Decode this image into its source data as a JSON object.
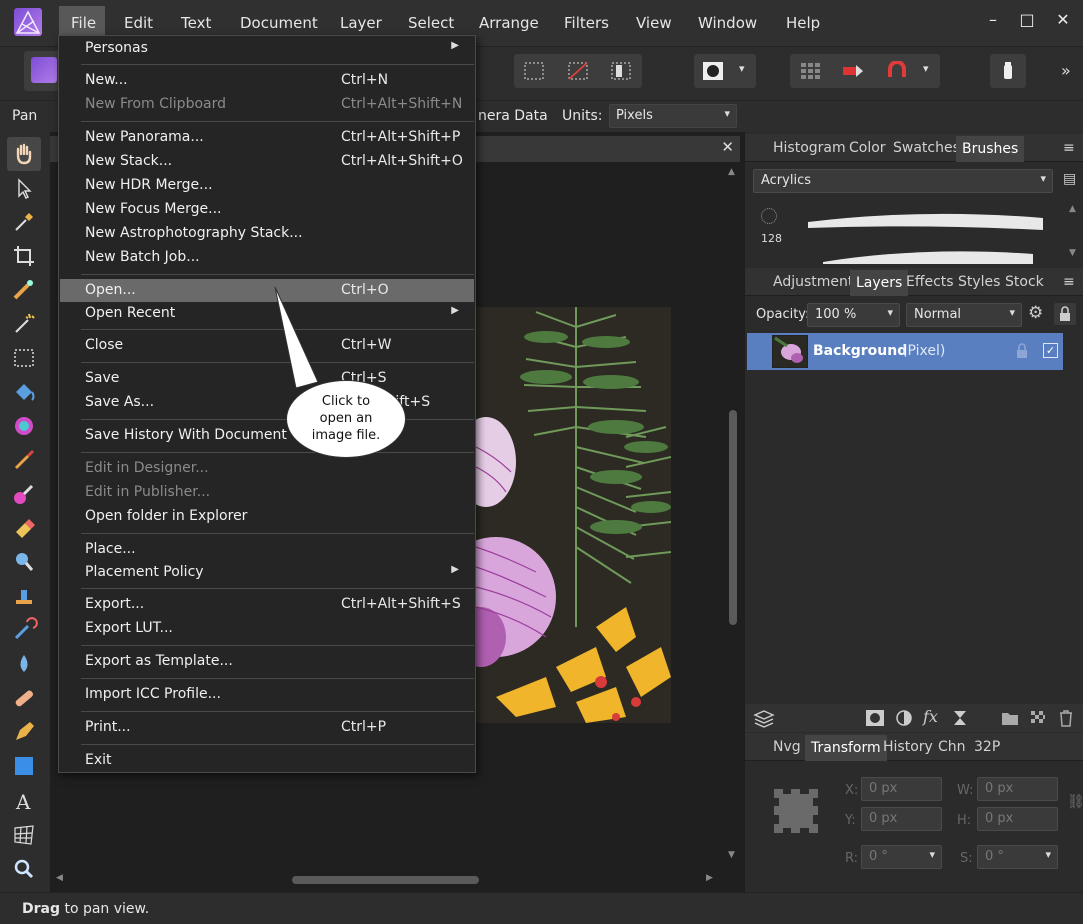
{
  "menubar": {
    "items": [
      "File",
      "Edit",
      "Text",
      "Document",
      "Layer",
      "Select",
      "Arrange",
      "Filters",
      "View",
      "Window",
      "Help"
    ],
    "window_controls": [
      "–",
      "□",
      "✕"
    ]
  },
  "toolbar": {
    "more_icon": "»"
  },
  "context_bar": {
    "tool_label": "Pan",
    "camera_data_partial": "nera Data",
    "units_label": "Units:",
    "units_value": "Pixels"
  },
  "file_menu": {
    "items": [
      {
        "label": "Personas",
        "shortcut": "",
        "submenu": true,
        "disabled": false
      },
      {
        "label": "New...",
        "shortcut": "Ctrl+N",
        "submenu": false,
        "disabled": false
      },
      {
        "label": "New From Clipboard",
        "shortcut": "Ctrl+Alt+Shift+N",
        "submenu": false,
        "disabled": true
      },
      {
        "label": "New Panorama...",
        "shortcut": "Ctrl+Alt+Shift+P",
        "submenu": false,
        "disabled": false
      },
      {
        "label": "New Stack...",
        "shortcut": "Ctrl+Alt+Shift+O",
        "submenu": false,
        "disabled": false
      },
      {
        "label": "New HDR Merge...",
        "shortcut": "",
        "submenu": false,
        "disabled": false
      },
      {
        "label": "New Focus Merge...",
        "shortcut": "",
        "submenu": false,
        "disabled": false
      },
      {
        "label": "New Astrophotography Stack...",
        "shortcut": "",
        "submenu": false,
        "disabled": false
      },
      {
        "label": "New Batch Job...",
        "shortcut": "",
        "submenu": false,
        "disabled": false
      },
      {
        "label": "Open...",
        "shortcut": "Ctrl+O",
        "submenu": false,
        "disabled": false,
        "highlighted": true
      },
      {
        "label": "Open Recent",
        "shortcut": "",
        "submenu": true,
        "disabled": false
      },
      {
        "label": "Close",
        "shortcut": "Ctrl+W",
        "submenu": false,
        "disabled": false
      },
      {
        "label": "Save",
        "shortcut": "Ctrl+S",
        "submenu": false,
        "disabled": false
      },
      {
        "label": "Save As...",
        "shortcut": "Ctrl+Shift+S",
        "submenu": false,
        "disabled": false
      },
      {
        "label": "Save History With Document",
        "shortcut": "",
        "submenu": false,
        "disabled": false
      },
      {
        "label": "Edit in Designer...",
        "shortcut": "",
        "submenu": false,
        "disabled": true
      },
      {
        "label": "Edit in Publisher...",
        "shortcut": "",
        "submenu": false,
        "disabled": true
      },
      {
        "label": "Open folder in Explorer",
        "shortcut": "",
        "submenu": false,
        "disabled": false
      },
      {
        "label": "Place...",
        "shortcut": "",
        "submenu": false,
        "disabled": false
      },
      {
        "label": "Placement Policy",
        "shortcut": "",
        "submenu": true,
        "disabled": false
      },
      {
        "label": "Export...",
        "shortcut": "Ctrl+Alt+Shift+S",
        "submenu": false,
        "disabled": false
      },
      {
        "label": "Export LUT...",
        "shortcut": "",
        "submenu": false,
        "disabled": false
      },
      {
        "label": "Export as Template...",
        "shortcut": "",
        "submenu": false,
        "disabled": false
      },
      {
        "label": "Import ICC Profile...",
        "shortcut": "",
        "submenu": false,
        "disabled": false
      },
      {
        "label": "Print...",
        "shortcut": "Ctrl+P",
        "submenu": false,
        "disabled": false
      },
      {
        "label": "Exit",
        "shortcut": "",
        "submenu": false,
        "disabled": false
      }
    ]
  },
  "callout": {
    "text": "Click to open an image file."
  },
  "brushes_panel": {
    "tabs": [
      "Histogram",
      "Color",
      "Swatches",
      "Brushes"
    ],
    "active_tab": "Brushes",
    "category": "Acrylics",
    "brush_size": "128"
  },
  "layers_panel": {
    "tabs": [
      "Adjustment",
      "Layers",
      "Effects",
      "Styles",
      "Stock"
    ],
    "active_tab": "Layers",
    "opacity_label": "Opacity:",
    "opacity_value": "100 %",
    "blend_mode": "Normal",
    "layer_name": "Background",
    "layer_type": "(Pixel)"
  },
  "transform_panel": {
    "tabs": [
      "Nvg",
      "Transform",
      "History",
      "Chn",
      "32P"
    ],
    "active_tab": "Transform",
    "x_label": "X:",
    "x_value": "0 px",
    "y_label": "Y:",
    "y_value": "0 px",
    "w_label": "W:",
    "w_value": "0 px",
    "h_label": "H:",
    "h_value": "0 px",
    "r_label": "R:",
    "r_value": "0 °",
    "s_label": "S:",
    "s_value": "0 °"
  },
  "status": {
    "bold": "Drag",
    "rest": " to pan view."
  },
  "colors": {
    "accent": "#7c4dd6",
    "layer_selected": "#5a7fc0",
    "menu_highlight": "#6a6a6a"
  }
}
